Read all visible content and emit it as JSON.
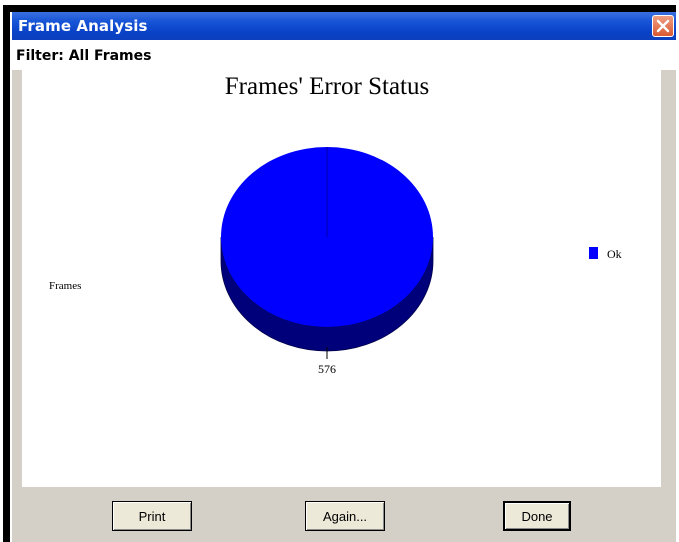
{
  "window": {
    "title": "Frame Analysis",
    "close_icon": "close-icon",
    "title_color": "#0b3fbd",
    "close_color": "#d95a33"
  },
  "filter": {
    "label": "Filter: All Frames"
  },
  "chart_data": {
    "type": "pie",
    "title": "Frames' Error Status",
    "series_label": "Frames",
    "slices": [
      {
        "label": "Ok",
        "value": 576,
        "color": "#0000ff"
      }
    ],
    "data_labels": [
      "576"
    ],
    "legend": {
      "placement": "right",
      "entries": [
        "Ok"
      ]
    }
  },
  "buttons": {
    "print": "Print",
    "again": "Again...",
    "done": "Done"
  }
}
